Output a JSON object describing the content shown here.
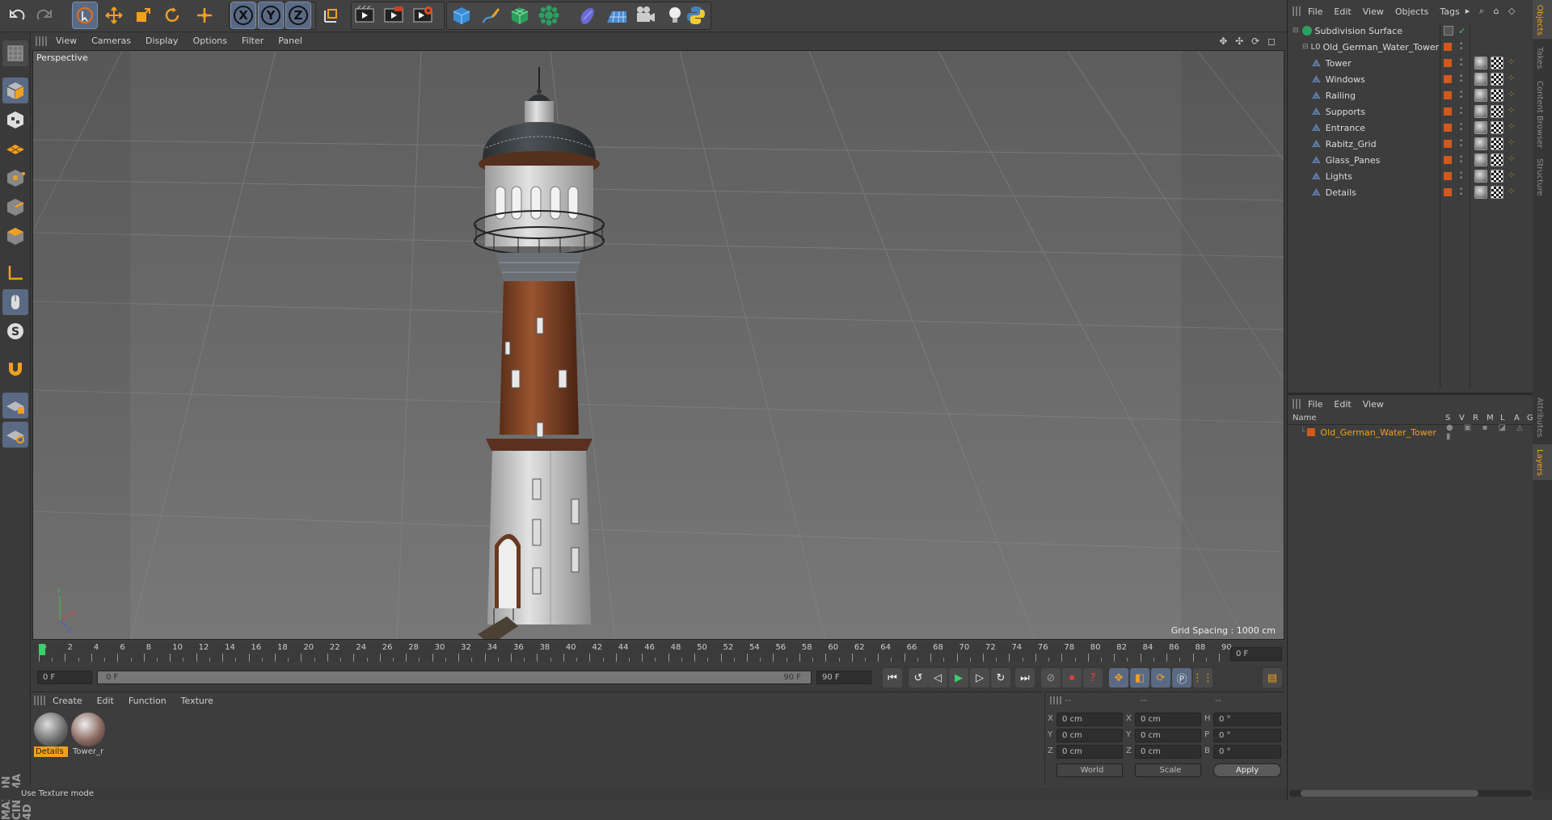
{
  "app": {
    "brand": "MAXON CINEMA 4D"
  },
  "toolbar": {
    "axis_x": "X",
    "axis_y": "Y",
    "axis_z": "Z",
    "icons": [
      "undo-icon",
      "redo-icon",
      "live-select-icon",
      "move-icon",
      "scale-icon",
      "rotate-icon",
      "transform-icon",
      "x-axis-icon",
      "y-axis-icon",
      "z-axis-icon",
      "coordinate-system-icon",
      "render-view-icon",
      "render-picture-viewer-icon",
      "render-settings-icon",
      "cube-primitive-icon",
      "pen-spline-icon",
      "subdivision-icon",
      "array-icon",
      "deformer-icon",
      "floor-icon",
      "camera-icon",
      "light-icon",
      "python-icon"
    ]
  },
  "viewport": {
    "menu": [
      "View",
      "Cameras",
      "Display",
      "Options",
      "Filter",
      "Panel"
    ],
    "label": "Perspective",
    "grid_spacing": "Grid Spacing : 1000 cm"
  },
  "timeline": {
    "ticks": [
      "0",
      "2",
      "4",
      "6",
      "8",
      "10",
      "12",
      "14",
      "16",
      "18",
      "20",
      "22",
      "24",
      "26",
      "28",
      "30",
      "32",
      "34",
      "36",
      "38",
      "40",
      "42",
      "44",
      "46",
      "48",
      "50",
      "52",
      "54",
      "56",
      "58",
      "60",
      "62",
      "64",
      "66",
      "68",
      "70",
      "72",
      "74",
      "76",
      "78",
      "80",
      "82",
      "84",
      "86",
      "88",
      "90"
    ],
    "current_frame": "0 F"
  },
  "anim": {
    "start": "0 F",
    "range_start": "0 F",
    "range_end": "90 F",
    "end": "90 F"
  },
  "materials": {
    "menu": [
      "Create",
      "Edit",
      "Function",
      "Texture"
    ],
    "items": [
      {
        "label": "Details"
      },
      {
        "label": "Tower_r"
      }
    ]
  },
  "coords": {
    "headers": [
      "--",
      "--",
      "--"
    ],
    "rows": [
      {
        "axis": "X",
        "pos": "0 cm",
        "axis2": "X",
        "size": "0 cm",
        "rlabel": "H",
        "rot": "0 °"
      },
      {
        "axis": "Y",
        "pos": "0 cm",
        "axis2": "Y",
        "size": "0 cm",
        "rlabel": "P",
        "rot": "0 °"
      },
      {
        "axis": "Z",
        "pos": "0 cm",
        "axis2": "Z",
        "size": "0 cm",
        "rlabel": "B",
        "rot": "0 °"
      }
    ],
    "space": "World",
    "mode": "Scale",
    "apply": "Apply"
  },
  "objects": {
    "menu": [
      "File",
      "Edit",
      "View",
      "Objects",
      "Tags"
    ],
    "root": "Subdivision Surface",
    "group": "Old_German_Water_Tower",
    "children": [
      "Tower",
      "Windows",
      "Railing",
      "Supports",
      "Entrance",
      "Rabitz_Grid",
      "Glass_Panes",
      "Lights",
      "Details"
    ]
  },
  "layers": {
    "menu": [
      "File",
      "Edit",
      "View"
    ],
    "columns": [
      "Name",
      "S",
      "V",
      "R",
      "M",
      "L",
      "A",
      "G"
    ],
    "rows": [
      "Old_German_Water_Tower"
    ]
  },
  "side_tabs": {
    "top": [
      "Objects",
      "Takes",
      "Content Browser",
      "Structure"
    ],
    "bottom": [
      "Attributes",
      "Layers"
    ]
  },
  "status": "Use Texture mode",
  "colors": {
    "accent": "#f0a020",
    "layer_orange": "#d05a1e",
    "selected_material": "#f0a020"
  }
}
